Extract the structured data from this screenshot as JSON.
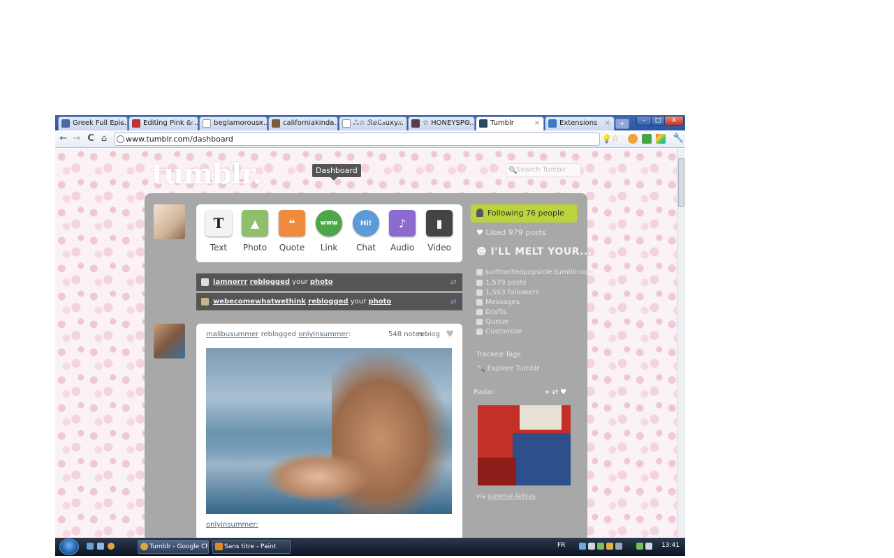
{
  "browser": {
    "tabs": [
      {
        "label": "Greek Full Epis...",
        "active": false
      },
      {
        "label": "Editing Pink & ...",
        "active": false
      },
      {
        "label": "beglamorousx...",
        "active": false
      },
      {
        "label": "californiakinda...",
        "active": false
      },
      {
        "label": "ஃ☆ ℛℯℒℴuxy...",
        "active": false
      },
      {
        "label": "☆ HONEYSPO...",
        "active": false
      },
      {
        "label": "Tumblr",
        "active": true
      },
      {
        "label": "Extensions",
        "active": false
      }
    ],
    "new_tab": "+",
    "window_controls": {
      "minimize": "–",
      "maximize": "□",
      "close": "X"
    },
    "nav": {
      "back": "←",
      "forward": "→",
      "reload": "C",
      "home": "⌂"
    },
    "url": "www.tumblr.com/dashboard"
  },
  "tumblr": {
    "logo": "tumblr.",
    "dashboard_tooltip": "Dashboard",
    "search_placeholder": "Search Tumblr",
    "post_types": [
      {
        "label": "Text",
        "icon": "text-post-icon",
        "glyph": "T",
        "color": "#f3f3f3"
      },
      {
        "label": "Photo",
        "icon": "photo-post-icon",
        "glyph": "▲",
        "color": "#8fbf6a"
      },
      {
        "label": "Quote",
        "icon": "quote-post-icon",
        "glyph": "❝",
        "color": "#f08a3c"
      },
      {
        "label": "Link",
        "icon": "link-post-icon",
        "glyph": "www",
        "color": "#4ea64a"
      },
      {
        "label": "Chat",
        "icon": "chat-post-icon",
        "glyph": "Hi!",
        "color": "#5b9bd8"
      },
      {
        "label": "Audio",
        "icon": "audio-post-icon",
        "glyph": "♪",
        "color": "#8d6ad0"
      },
      {
        "label": "Video",
        "icon": "video-post-icon",
        "glyph": "▮",
        "color": "#444444"
      }
    ],
    "notifications": [
      {
        "user": "iamnorrr",
        "action": "reblogged",
        "middle": " your ",
        "object": "photo"
      },
      {
        "user": "webecomewhatwethink",
        "action": "reblogged",
        "middle": " your ",
        "object": "photo"
      }
    ],
    "post": {
      "author": "malibusummer",
      "verb": " reblogged ",
      "source": "onlyinsummer",
      "suffix": ":",
      "notes": "548 notes",
      "reblog": "reblog",
      "caption_link": "onlyinsummer",
      "caption_suffix": ":"
    },
    "sidebar": {
      "following": "Following 76 people",
      "liked": "Liked 979 posts",
      "blog_title": "I'LL MELT YOUR...",
      "blog_url": "surfmeltedpopsicle.tumblr.com",
      "posts": "1,579 posts",
      "followers": "1,563 followers",
      "messages": "Messages",
      "drafts": "Drafts",
      "queue": "Queue",
      "customize": "Customize",
      "tracked_tags_heading": "Tracked Tags",
      "explore": "Explore Tumblr",
      "radar_heading": "Radar",
      "radar_via_prefix": "via ",
      "radar_via_user": "summer-jellyes"
    }
  },
  "taskbar": {
    "tasks": [
      {
        "label": "Tumblr - Google Ch..."
      },
      {
        "label": "Sans titre - Paint"
      }
    ],
    "language": "FR",
    "clock": "13:41"
  }
}
